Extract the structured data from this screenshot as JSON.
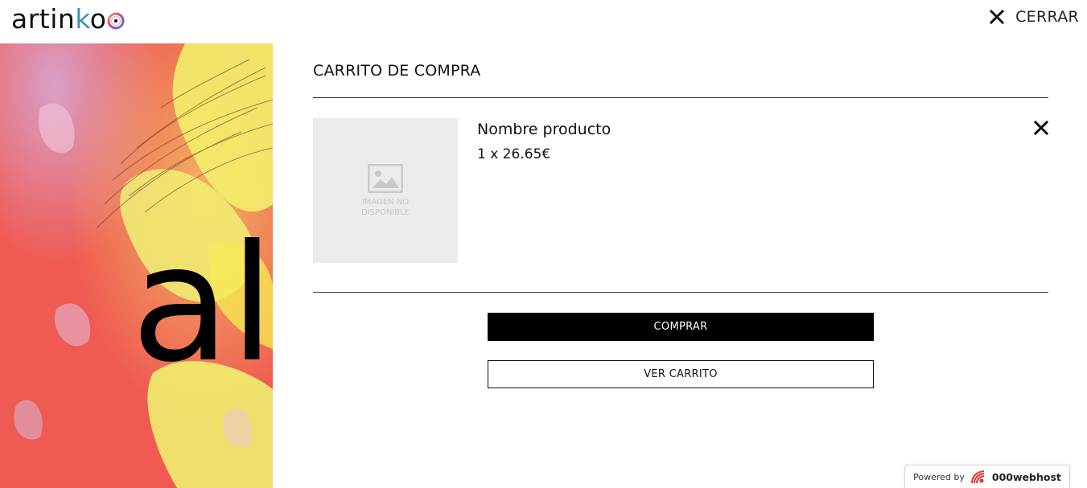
{
  "header": {
    "logo_prefix": "artin",
    "logo_blue": "k",
    "logo_suffix": "o",
    "close_label": "CERRAR"
  },
  "hero": {
    "letters": "al"
  },
  "cart": {
    "title": "CARRITO DE COMPRA",
    "items": [
      {
        "name": "Nombre producto",
        "price": "1 x 26.65€",
        "image_placeholder": "IMAGEN NO\nDISPONIBLE"
      }
    ],
    "buy_label": "COMPRAR",
    "view_cart_label": "VER CARRITO"
  },
  "footer_badge": {
    "label": "Powered by",
    "brand": "000webhost"
  },
  "colors": {
    "accent_blue": "#3a94b7",
    "button_dark": "#000000",
    "placeholder_bg": "#ebebeb"
  },
  "icons": {
    "close": "close-icon",
    "remove": "remove-item-icon",
    "image_placeholder": "image-icon",
    "webhost_logo": "webhost-logo-icon"
  }
}
